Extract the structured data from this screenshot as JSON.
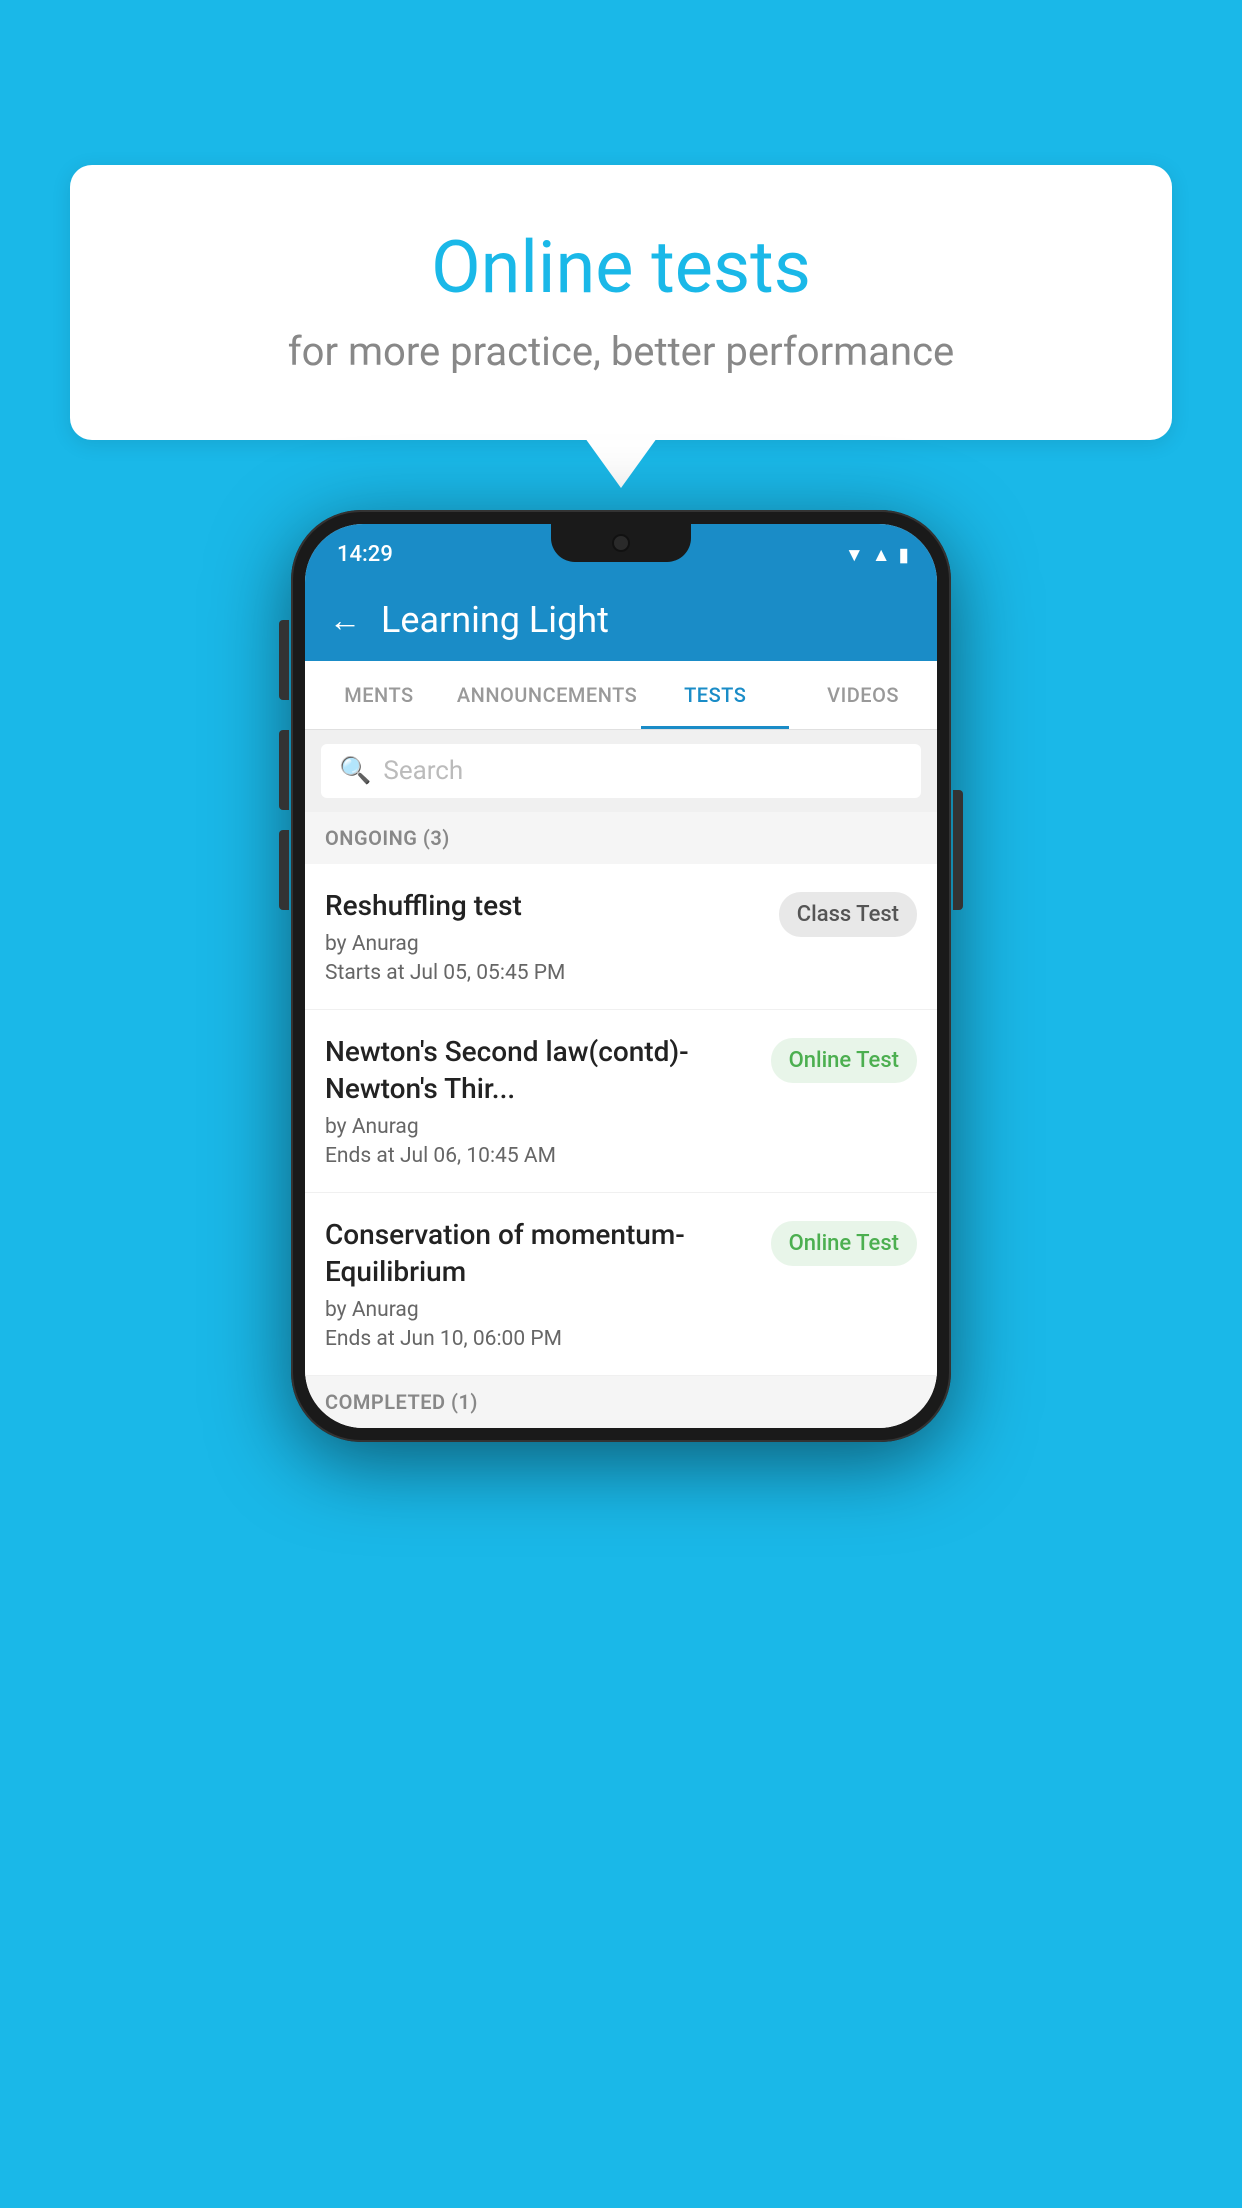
{
  "background": {
    "color": "#1ab8e8"
  },
  "speech_bubble": {
    "title": "Online tests",
    "subtitle": "for more practice, better performance"
  },
  "status_bar": {
    "time": "14:29",
    "wifi": "▼",
    "signal": "▲",
    "battery": "▮"
  },
  "app_header": {
    "back_label": "←",
    "title": "Learning Light"
  },
  "tabs": [
    {
      "label": "MENTS",
      "active": false
    },
    {
      "label": "ANNOUNCEMENTS",
      "active": false
    },
    {
      "label": "TESTS",
      "active": true
    },
    {
      "label": "VIDEOS",
      "active": false
    }
  ],
  "search": {
    "placeholder": "Search"
  },
  "ongoing_section": {
    "label": "ONGOING (3)"
  },
  "tests": [
    {
      "name": "Reshuffling test",
      "author": "by Anurag",
      "time_label": "Starts at",
      "time": "Jul 05, 05:45 PM",
      "badge": "Class Test",
      "badge_type": "class"
    },
    {
      "name": "Newton's Second law(contd)-Newton's Thir...",
      "author": "by Anurag",
      "time_label": "Ends at",
      "time": "Jul 06, 10:45 AM",
      "badge": "Online Test",
      "badge_type": "online"
    },
    {
      "name": "Conservation of momentum-Equilibrium",
      "author": "by Anurag",
      "time_label": "Ends at",
      "time": "Jun 10, 06:00 PM",
      "badge": "Online Test",
      "badge_type": "online"
    }
  ],
  "completed_section": {
    "label": "COMPLETED (1)"
  }
}
